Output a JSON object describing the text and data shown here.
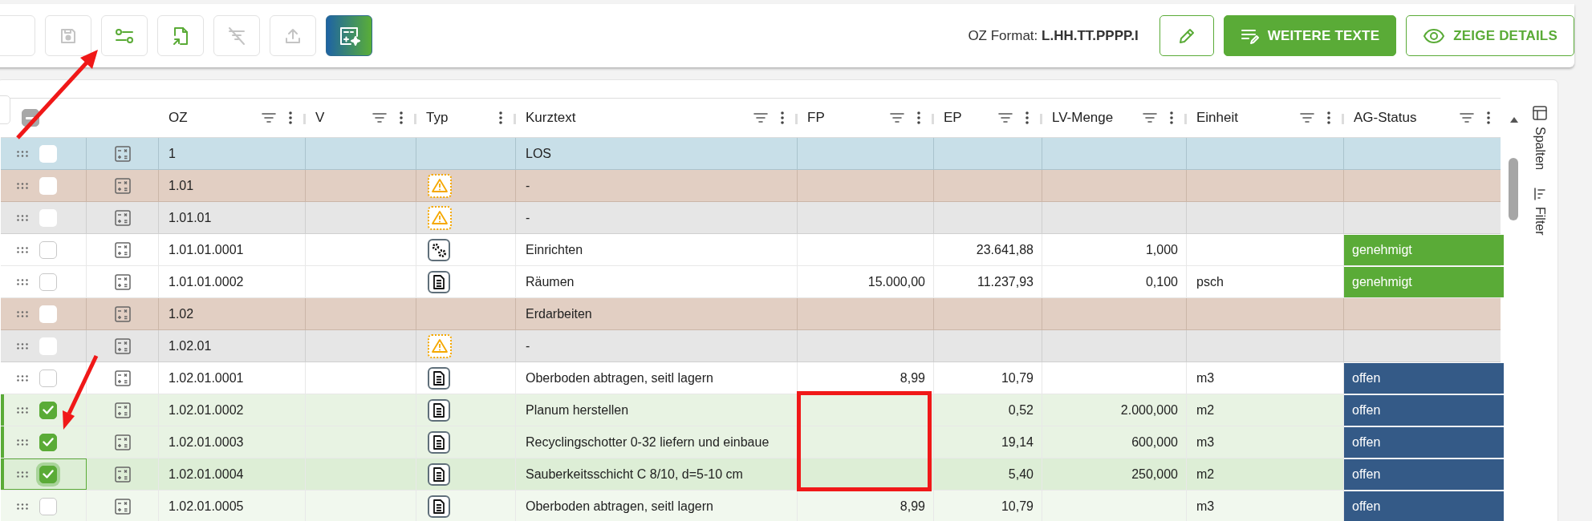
{
  "toolbar": {
    "buttons": [
      {
        "kind": "save",
        "disabled": true
      },
      {
        "kind": "settings",
        "disabled": false
      },
      {
        "kind": "import",
        "disabled": false
      },
      {
        "kind": "filteroff",
        "disabled": true
      },
      {
        "kind": "upload",
        "disabled": true
      },
      {
        "kind": "ai",
        "disabled": false
      }
    ],
    "oz_format_label": "OZ Format:",
    "oz_format_value": "L.HH.TT.PPPP.I",
    "actions": [
      {
        "kind": "edit"
      },
      {
        "kind": "texts",
        "label": "WEITERE TEXTE"
      },
      {
        "kind": "details",
        "label": "ZEIGE DETAILS"
      }
    ]
  },
  "table": {
    "header_checkbox": {
      "indeterminate": true
    },
    "columns": [
      {
        "label": "OZ",
        "filter": true
      },
      {
        "label": "V",
        "filter": true
      },
      {
        "label": "Typ",
        "filter": false
      },
      {
        "label": "Kurztext",
        "filter": true
      },
      {
        "label": "FP",
        "filter": true
      },
      {
        "label": "EP",
        "filter": true
      },
      {
        "label": "LV-Menge",
        "filter": true
      },
      {
        "label": "Einheit",
        "filter": true
      },
      {
        "label": "AG-Status",
        "filter": true
      }
    ],
    "rows": [
      {
        "kind": "los",
        "checked": false,
        "focused": false,
        "hovered": false,
        "oz": "1",
        "kurztext": "LOS"
      },
      {
        "kind": "title",
        "checked": false,
        "focused": false,
        "hovered": false,
        "oz": "1.01",
        "typ_icon": {
          "kind": "warning"
        },
        "kurztext": "-"
      },
      {
        "kind": "subtitle",
        "checked": false,
        "focused": false,
        "hovered": false,
        "oz": "1.01.01",
        "typ_icon": {
          "kind": "warning"
        },
        "kurztext": "-"
      },
      {
        "kind": "position",
        "checked": false,
        "focused": false,
        "hovered": false,
        "oz": "1.01.01.0001",
        "typ_icon": {
          "kind": "gears"
        },
        "kurztext": "Einrichten",
        "ep": "23.641,88",
        "lv_menge": "1,000",
        "status": {
          "text": "genehmigt",
          "color": "#5aab37"
        }
      },
      {
        "kind": "position",
        "checked": false,
        "focused": false,
        "hovered": false,
        "oz": "1.01.01.0002",
        "typ_icon": {
          "kind": "text"
        },
        "kurztext": "Räumen",
        "fp": "15.000,00",
        "ep": "11.237,93",
        "lv_menge": "0,100",
        "einheit": "psch",
        "status": {
          "text": "genehmigt",
          "color": "#5aab37"
        }
      },
      {
        "kind": "title",
        "checked": false,
        "focused": false,
        "hovered": false,
        "oz": "1.02",
        "kurztext": "Erdarbeiten"
      },
      {
        "kind": "subtitle",
        "checked": false,
        "focused": false,
        "hovered": false,
        "oz": "1.02.01",
        "typ_icon": {
          "kind": "warning"
        },
        "kurztext": "-"
      },
      {
        "kind": "position",
        "checked": false,
        "focused": false,
        "hovered": false,
        "oz": "1.02.01.0001",
        "typ_icon": {
          "kind": "text"
        },
        "kurztext": "Oberboden abtragen, seitl lagern",
        "fp": "8,99",
        "ep": "10,79",
        "einheit": "m3",
        "status": {
          "text": "offen",
          "color": "#345a87"
        }
      },
      {
        "kind": "position",
        "checked": true,
        "focused": false,
        "hovered": false,
        "oz": "1.02.01.0002",
        "typ_icon": {
          "kind": "text"
        },
        "kurztext": "Planum herstellen",
        "ep": "0,52",
        "lv_menge": "2.000,000",
        "einheit": "m2",
        "status": {
          "text": "offen",
          "color": "#345a87"
        }
      },
      {
        "kind": "position",
        "checked": true,
        "focused": false,
        "hovered": false,
        "oz": "1.02.01.0003",
        "typ_icon": {
          "kind": "text"
        },
        "kurztext": "Recyclingschotter 0-32 liefern und einbaue",
        "ep": "19,14",
        "lv_menge": "600,000",
        "einheit": "m3",
        "status": {
          "text": "offen",
          "color": "#345a87"
        }
      },
      {
        "kind": "position",
        "checked": true,
        "focused": true,
        "hovered": false,
        "oz": "1.02.01.0004",
        "typ_icon": {
          "kind": "text"
        },
        "kurztext": "Sauberkeitsschicht C 8/10, d=5-10 cm",
        "ep": "5,40",
        "lv_menge": "250,000",
        "einheit": "m2",
        "status": {
          "text": "offen",
          "color": "#345a87"
        }
      },
      {
        "kind": "position",
        "checked": false,
        "focused": false,
        "hovered": true,
        "oz": "1.02.01.0005",
        "typ_icon": {
          "kind": "text"
        },
        "kurztext": "Oberboden abtragen, seitl lagern",
        "fp": "8,99",
        "ep": "10,79",
        "einheit": "m3",
        "status": {
          "text": "offen",
          "color": "#345a87"
        }
      }
    ]
  },
  "side_panel": {
    "tabs": [
      {
        "kind": "columns",
        "label": "Spalten"
      },
      {
        "kind": "filter",
        "label": "Filter"
      }
    ]
  }
}
